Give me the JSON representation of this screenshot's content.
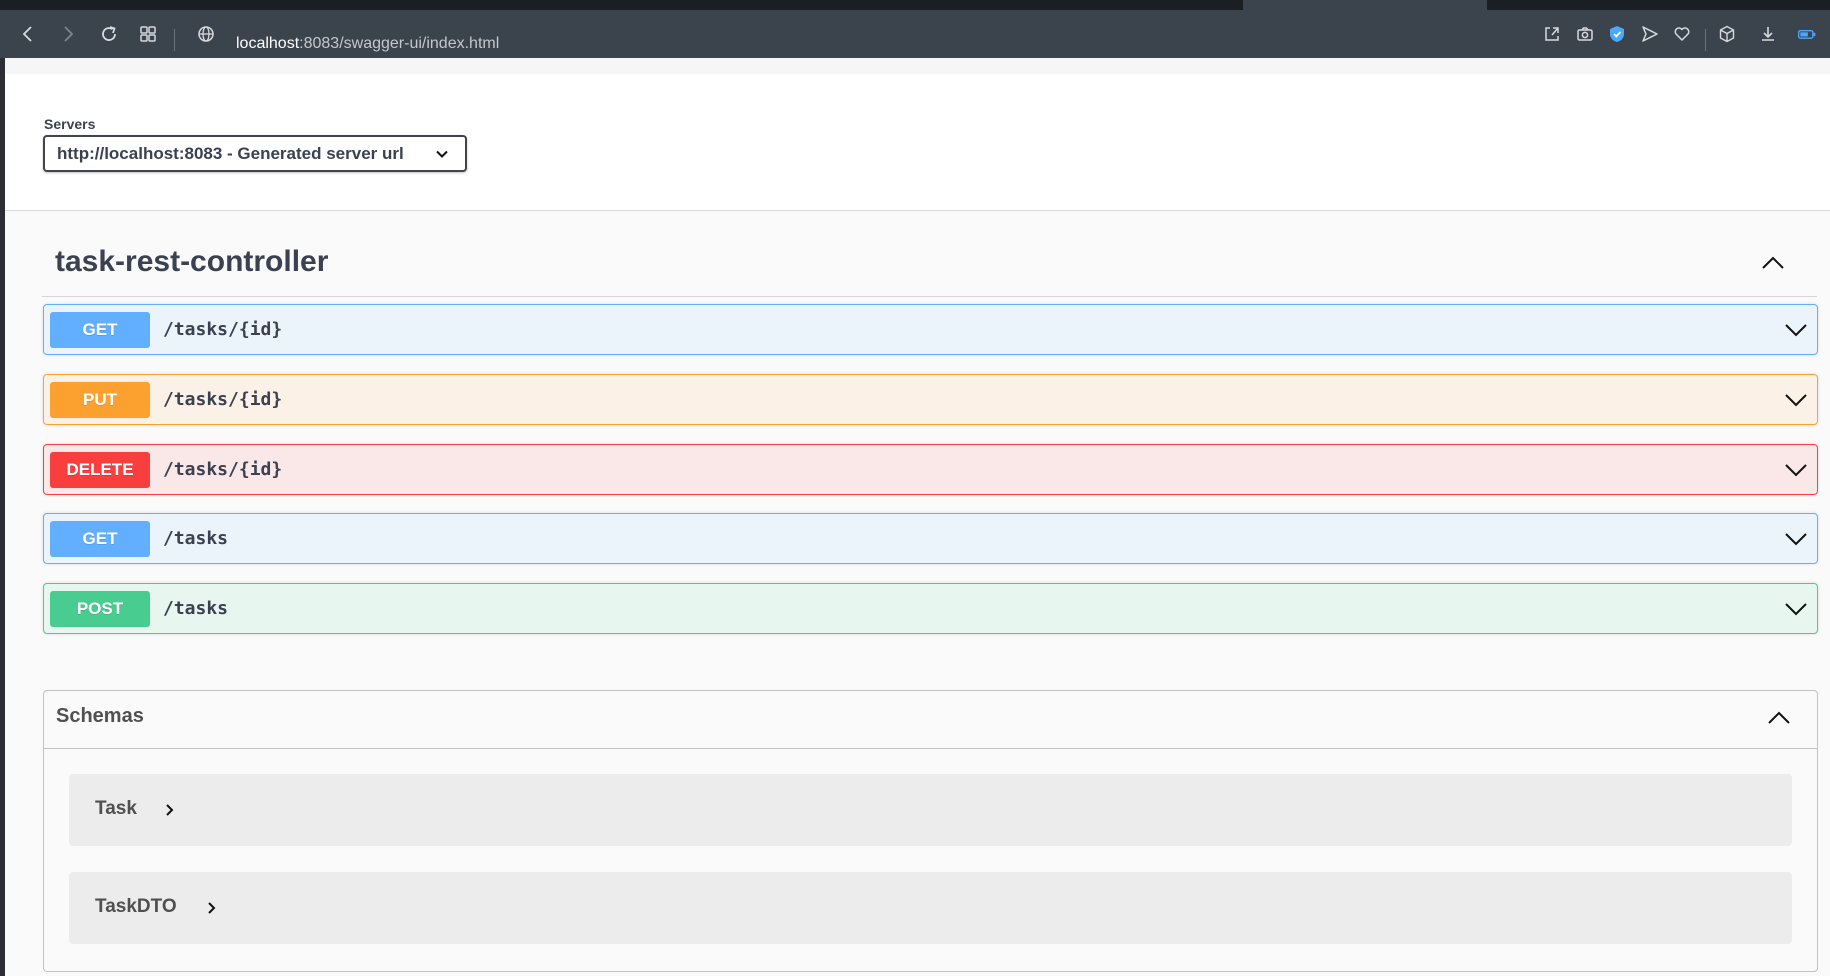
{
  "browser": {
    "url_host": "localhost",
    "url_rest": ":8083/swagger-ui/index.html",
    "icons": [
      "back-icon",
      "forward-icon",
      "reload-icon",
      "tabs-grid-icon",
      "globe-icon",
      "share-icon",
      "camera-icon",
      "shield-icon",
      "send-icon",
      "heart-icon",
      "box-icon",
      "download-icon",
      "battery-icon"
    ]
  },
  "servers": {
    "label": "Servers",
    "selected": "http://localhost:8083 - Generated server url"
  },
  "tag": {
    "title": "task-rest-controller"
  },
  "operations": [
    {
      "method": "GET",
      "path": "/tasks/{id}"
    },
    {
      "method": "PUT",
      "path": "/tasks/{id}"
    },
    {
      "method": "DELETE",
      "path": "/tasks/{id}"
    },
    {
      "method": "GET",
      "path": "/tasks"
    },
    {
      "method": "POST",
      "path": "/tasks"
    }
  ],
  "schemas": {
    "title": "Schemas",
    "models": [
      {
        "name": "Task"
      },
      {
        "name": "TaskDTO"
      }
    ]
  },
  "colors": {
    "get": "#61affe",
    "put": "#fca130",
    "delete": "#f93e3e",
    "post": "#49cc90",
    "text": "#3b4151"
  }
}
